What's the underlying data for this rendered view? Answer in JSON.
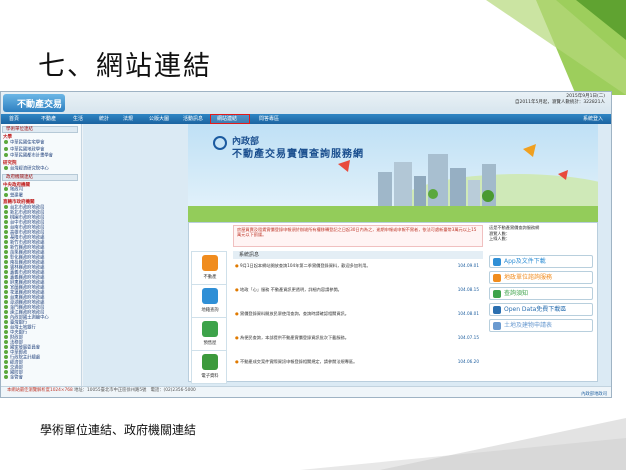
{
  "slide": {
    "title": "七、網站連結",
    "caption": "學術單位連結、政府機關連結"
  },
  "site": {
    "logo_text": "不動產交易",
    "header_info": [
      "2015年9月1日(二)",
      "自2011年5月起，瀏覽人數統計：322821人"
    ],
    "menu": [
      {
        "label": "首頁",
        "name": "menu-home"
      },
      {
        "label": "不動產",
        "name": "menu-realestate"
      },
      {
        "label": "生活",
        "name": "menu-life"
      },
      {
        "label": "統計",
        "name": "menu-stats"
      },
      {
        "label": "法規",
        "name": "menu-law"
      },
      {
        "label": "公版大圖",
        "name": "menu-map"
      },
      {
        "label": "活動訊息",
        "name": "menu-events"
      },
      {
        "label": "網站連結",
        "name": "menu-links"
      },
      {
        "label": "問答專區",
        "name": "menu-faq"
      }
    ],
    "menu_right": "系統登入",
    "sidebar": {
      "section1": "學術單位連結",
      "group1_head": "大學",
      "group1": [
        "中華民國住宅學會",
        "中華民國地政學會",
        "中華民國都市計畫學會"
      ],
      "group1b_head": "研究院",
      "group1b": [
        "台灣經濟研究院中心"
      ],
      "section2": "政府機關連結",
      "group2_head": "中央政府機關",
      "group2": [
        "地政司",
        "營建署"
      ],
      "group3_head": "直轄市政府機關",
      "group3": [
        "台北市政府地政局",
        "新北市政府地政局",
        "桃園市政府地政局",
        "台中市政府地政局",
        "台南市政府地政局",
        "高雄市政府地政局",
        "基隆市政府地政處",
        "新竹市政府地政處",
        "新竹縣政府地政處",
        "苗栗縣政府地政處",
        "彰化縣政府地政處",
        "南投縣政府地政處",
        "雲林縣政府地政處",
        "嘉義市政府地政處",
        "嘉義縣政府地政處",
        "屏東縣政府地政處",
        "宜蘭縣政府地政處",
        "花蓮縣政府地政處",
        "台東縣政府地政處",
        "澎湖縣政府地政處",
        "金門縣政府地政局",
        "連江縣政府地政局",
        "內政部國土測繪中心",
        "臺灣銀行",
        "台灣土地銀行",
        "中央銀行",
        "財政部",
        "法務部",
        "國家發展委員會",
        "中華郵政",
        "行政院主計總處",
        "經濟部",
        "交通部",
        "國防部",
        "金管會"
      ]
    },
    "banner": {
      "ministry": "內政部",
      "title": "不動產交易實價查詢服務網"
    },
    "quick_icons": [
      {
        "label": "不動產",
        "color": "#f08c1e"
      },
      {
        "label": "地籍查詢",
        "color": "#2f8fd6"
      },
      {
        "label": "預售屋",
        "color": "#3da34a"
      },
      {
        "label": "電子資料",
        "color": "#3c9a3c"
      }
    ],
    "notice": "房屋買賣及租賃實價登錄申報須於辦竣所有權移轉登記之日起30日內為之，逾期申報或申報不實者，依法可處新臺幣3萬元以上15萬元以下罰鍰。",
    "news_title": "系統訊息",
    "news": [
      {
        "text": "9月1日起本網站開放查詢104年第二季實價登錄資料，歡迎多加利用。",
        "date": "104.09.01"
      },
      {
        "text": "地政「心」服務 不動產資訊更透明，詳細內容請參閱。",
        "date": "104.08.15"
      },
      {
        "text": "實價登錄資料開放民眾使用查詢，查詢時請確認相關資訊。",
        "date": "104.08.01"
      },
      {
        "text": "為便民查詢，本部提供不動產實價登錄資訊批次下載服務。",
        "date": "104.07.15"
      },
      {
        "text": "不動產成交案件實際資訊申報登錄相關規定，請參閱法規專區。",
        "date": "104.06.20"
      }
    ],
    "right_info": [
      "這是不動產實價查詢服務網",
      "瀏覽人數：",
      "上線人數："
    ],
    "right_buttons": [
      {
        "label": "App及文件下載",
        "color": "#2f8fd6"
      },
      {
        "label": "地政單位諮詢服務",
        "color": "#f08c1e"
      },
      {
        "label": "查詢須知",
        "color": "#3da34a"
      },
      {
        "label": "Open Data免費下載區",
        "color": "#2a6fb0"
      },
      {
        "label": "土地及建物申請表",
        "color": "#6a9ad0"
      }
    ],
    "footer_line1": "本網站最佳瀏覽解析度1024×768",
    "footer_line2": "地址：10055臺北市中正區徐州路5號　電話：(02)2356-5000",
    "footer_right": "內政部地政司"
  }
}
